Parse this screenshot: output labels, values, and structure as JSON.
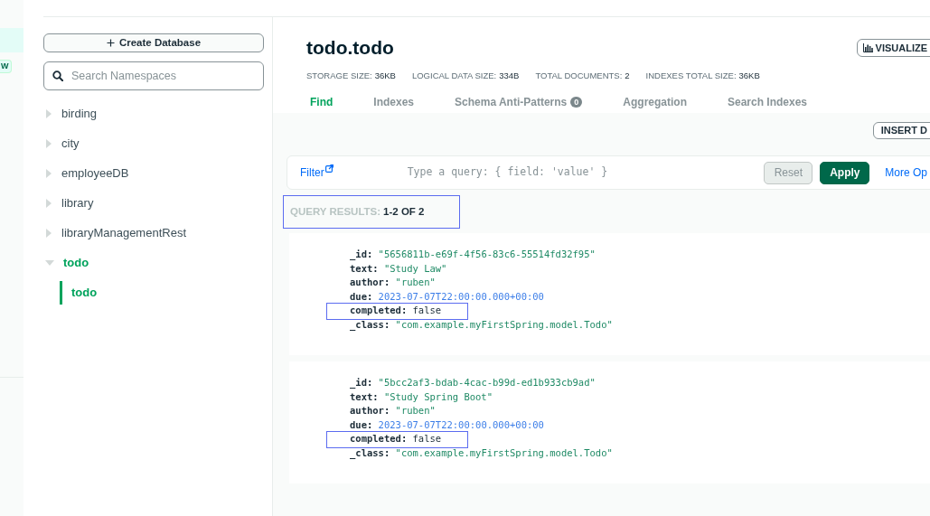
{
  "left_rail": {
    "items": [
      {
        "selected": true
      }
    ],
    "badge": "W"
  },
  "sidebar": {
    "create_button": "Create Database",
    "search": {
      "placeholder": "Search Namespaces"
    },
    "databases": [
      {
        "name": "birding",
        "expanded": false,
        "selected": false
      },
      {
        "name": "city",
        "expanded": false,
        "selected": false
      },
      {
        "name": "employeeDB",
        "expanded": false,
        "selected": false
      },
      {
        "name": "library",
        "expanded": false,
        "selected": false
      },
      {
        "name": "libraryManagementRest",
        "expanded": false,
        "selected": false
      },
      {
        "name": "todo",
        "expanded": true,
        "selected": true,
        "children": [
          {
            "name": "todo",
            "selected": true
          }
        ]
      }
    ]
  },
  "collection": {
    "title": "todo.todo",
    "visualize_button": "VISUALIZE",
    "stats": [
      {
        "label": "STORAGE SIZE:",
        "value": "36KB"
      },
      {
        "label": "LOGICAL DATA SIZE:",
        "value": "334B"
      },
      {
        "label": "TOTAL DOCUMENTS:",
        "value": "2"
      },
      {
        "label": "INDEXES TOTAL SIZE:",
        "value": "36KB"
      }
    ],
    "tabs": [
      {
        "label": "Find",
        "selected": true
      },
      {
        "label": "Indexes",
        "selected": false
      },
      {
        "label": "Schema Anti-Patterns",
        "selected": false,
        "badge": "0"
      },
      {
        "label": "Aggregation",
        "selected": false
      },
      {
        "label": "Search Indexes",
        "selected": false
      }
    ]
  },
  "toolbar": {
    "insert_button": "INSERT D"
  },
  "filter": {
    "label": "Filter",
    "placeholder": "Type a query: { field: 'value' }",
    "reset_button": {
      "label": "Reset",
      "disabled": true
    },
    "apply_button": "Apply",
    "more_options": "More Op"
  },
  "query_results": {
    "label": "QUERY RESULTS:",
    "range": "1-2 OF 2",
    "highlighted": true
  },
  "documents": [
    {
      "fields": [
        {
          "key": "_id:",
          "value": "\"5656811b-e69f-4f56-83c6-55514fd32f95\"",
          "kind": "string",
          "highlighted": false
        },
        {
          "key": "text:",
          "value": "\"Study Law\"",
          "kind": "string",
          "highlighted": false
        },
        {
          "key": "author:",
          "value": "\"ruben\"",
          "kind": "string",
          "highlighted": false
        },
        {
          "key": "due:",
          "value": "2023-07-07T22:00:00.000+00:00",
          "kind": "date",
          "highlighted": false
        },
        {
          "key": "completed:",
          "value": "false",
          "kind": "boolean",
          "highlighted": true
        },
        {
          "key": "_class:",
          "value": "\"com.example.myFirstSpring.model.Todo\"",
          "kind": "string",
          "highlighted": false
        }
      ]
    },
    {
      "fields": [
        {
          "key": "_id:",
          "value": "\"5bcc2af3-bdab-4cac-b99d-ed1b933cb9ad\"",
          "kind": "string",
          "highlighted": false
        },
        {
          "key": "text:",
          "value": "\"Study Spring Boot\"",
          "kind": "string",
          "highlighted": false
        },
        {
          "key": "author:",
          "value": "\"ruben\"",
          "kind": "string",
          "highlighted": false
        },
        {
          "key": "due:",
          "value": "2023-07-07T22:00:00.000+00:00",
          "kind": "date",
          "highlighted": false
        },
        {
          "key": "completed:",
          "value": "false",
          "kind": "boolean",
          "highlighted": true
        },
        {
          "key": "_class:",
          "value": "\"com.example.myFirstSpring.model.Todo\"",
          "kind": "string",
          "highlighted": false
        }
      ]
    }
  ]
}
